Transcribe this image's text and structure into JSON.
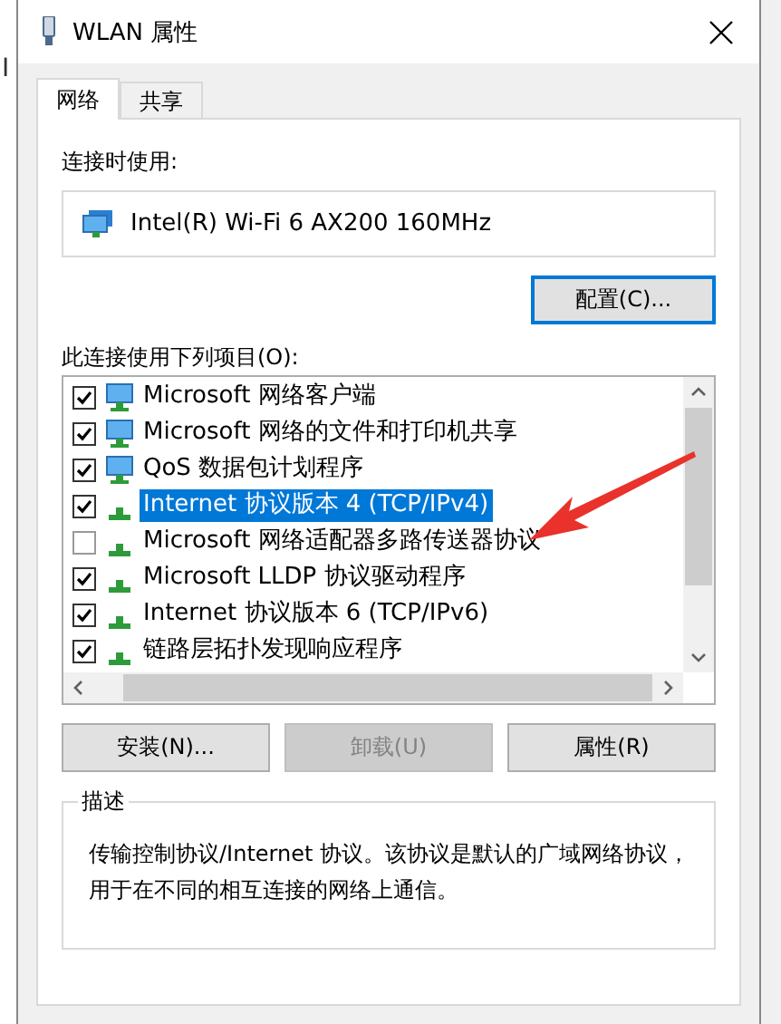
{
  "background_window": {
    "text": "I"
  },
  "window": {
    "title": "WLAN 属性"
  },
  "tabs": [
    {
      "label": "网络",
      "selected": true
    },
    {
      "label": "共享",
      "selected": false
    }
  ],
  "adapter_label": "连接时使用:",
  "adapter": {
    "name": "Intel(R) Wi-Fi 6 AX200 160MHz"
  },
  "configure_button": {
    "label": "配置(C)...",
    "focused": true
  },
  "components_label": "此连接使用下列项目(O):",
  "components": [
    {
      "label": "Microsoft 网络客户端",
      "kind": "client",
      "checked": true,
      "selected": false
    },
    {
      "label": "Microsoft 网络的文件和打印机共享",
      "kind": "client",
      "checked": true,
      "selected": false
    },
    {
      "label": "QoS 数据包计划程序",
      "kind": "client",
      "checked": true,
      "selected": false
    },
    {
      "label": "Internet 协议版本 4 (TCP/IPv4)",
      "kind": "protocol",
      "checked": true,
      "selected": true
    },
    {
      "label": "Microsoft 网络适配器多路传送器协议",
      "kind": "protocol",
      "checked": false,
      "selected": false
    },
    {
      "label": "Microsoft LLDP 协议驱动程序",
      "kind": "protocol",
      "checked": true,
      "selected": false
    },
    {
      "label": "Internet 协议版本 6 (TCP/IPv6)",
      "kind": "protocol",
      "checked": true,
      "selected": false
    },
    {
      "label": "链路层拓扑发现响应程序",
      "kind": "protocol",
      "checked": true,
      "selected": false
    }
  ],
  "buttons": [
    {
      "label": "安装(N)...",
      "disabled": false
    },
    {
      "label": "卸载(U)",
      "disabled": true
    },
    {
      "label": "属性(R)",
      "disabled": false
    }
  ],
  "description": {
    "legend": "描述",
    "text": "传输控制协议/Internet 协议。该协议是默认的广域网络协议，用于在不同的相互连接的网络上通信。"
  }
}
